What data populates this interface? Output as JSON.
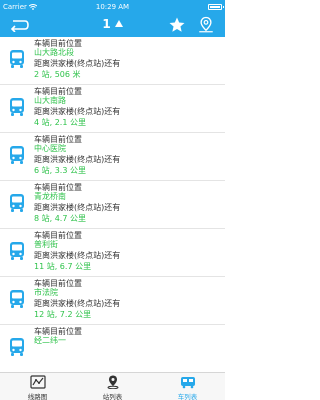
{
  "status_bar": {
    "carrier": "Carrier",
    "time": "10:29 AM"
  },
  "nav": {
    "title": "1",
    "back_icon": "back-icon",
    "star_icon": "star-icon",
    "map_icon": "map-pin-icon",
    "color": "#26a8ea"
  },
  "items": [
    {
      "header": "车辆目前位置",
      "location": "山大路北段",
      "remaining_label": "距离洪家楼(终点站)还有",
      "distance": "2 站, 506 米"
    },
    {
      "header": "车辆目前位置",
      "location": "山大南路",
      "remaining_label": "距离洪家楼(终点站)还有",
      "distance": "4 站, 2.1 公里"
    },
    {
      "header": "车辆目前位置",
      "location": "中心医院",
      "remaining_label": "距离洪家楼(终点站)还有",
      "distance": "6 站, 3.3 公里"
    },
    {
      "header": "车辆目前位置",
      "location": "青龙桥南",
      "remaining_label": "距离洪家楼(终点站)还有",
      "distance": "8 站, 4.7 公里"
    },
    {
      "header": "车辆目前位置",
      "location": "普利街",
      "remaining_label": "距离洪家楼(终点站)还有",
      "distance": "11 站, 6.7 公里"
    },
    {
      "header": "车辆目前位置",
      "location": "市法院",
      "remaining_label": "距离洪家楼(终点站)还有",
      "distance": "12 站, 7.2 公里"
    },
    {
      "header": "车辆目前位置",
      "location": "经二纬一",
      "remaining_label": "",
      "distance": ""
    }
  ],
  "tabs": [
    {
      "label": "线路图",
      "icon": "route-map-icon",
      "active": false
    },
    {
      "label": "站列表",
      "icon": "station-pin-icon",
      "active": false
    },
    {
      "label": "车列表",
      "icon": "bus-list-icon",
      "active": true
    }
  ],
  "colors": {
    "accent": "#26a8ea",
    "green": "#2ec24a"
  }
}
